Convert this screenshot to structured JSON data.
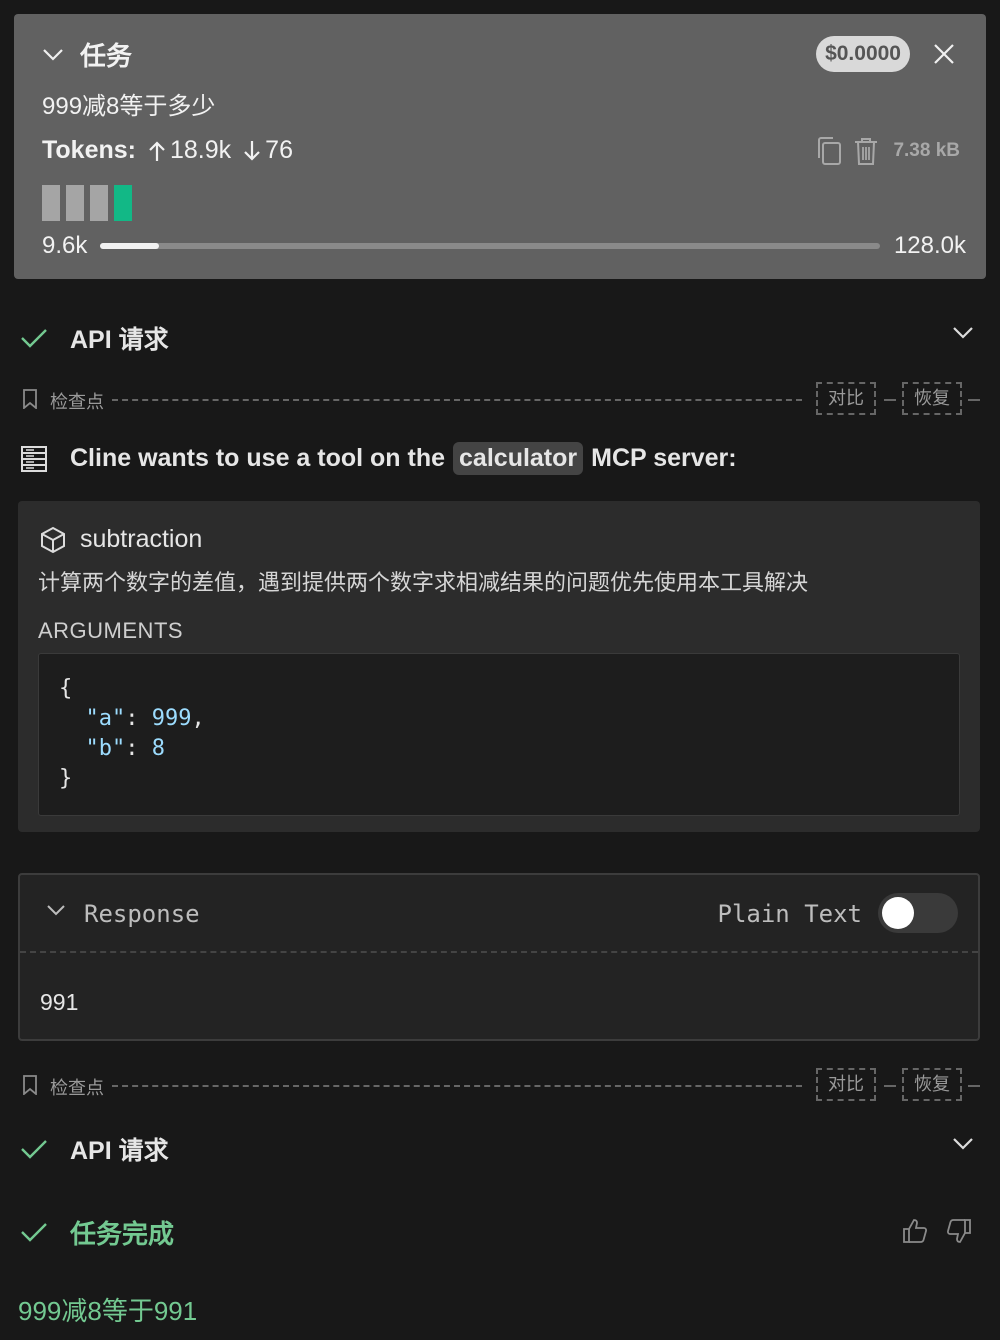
{
  "task": {
    "title": "任务",
    "cost": "$0.0000",
    "question": "999减8等于多少",
    "tokens_label": "Tokens:",
    "tokens_in": "18.9k",
    "tokens_out": "76",
    "size": "7.38 kB",
    "context_used": "9.6k",
    "context_total": "128.0k",
    "context_fraction": 0.075
  },
  "api_requests": [
    {
      "label": "API 请求"
    },
    {
      "label": "API 请求"
    }
  ],
  "checkpoints": [
    {
      "label": "检查点",
      "compare": "对比",
      "restore": "恢复"
    },
    {
      "label": "检查点",
      "compare": "对比",
      "restore": "恢复"
    }
  ],
  "mcp": {
    "intro_before": "Cline wants to use a tool on the",
    "server": "calculator",
    "intro_after": "MCP server:",
    "tool_name": "subtraction",
    "tool_description": "计算两个数字的差值，遇到提供两个数字求相减结果的问题优先使用本工具解决",
    "arguments_label": "ARGUMENTS",
    "arguments": {
      "open": "{",
      "a_key": "\"a\"",
      "a_val": "999",
      "b_key": "\"b\"",
      "b_val": "8",
      "close": "}"
    }
  },
  "response": {
    "title": "Response",
    "plain_text_label": "Plain Text",
    "plain_text_on": false,
    "body": "991"
  },
  "completion": {
    "label": "任务完成",
    "answer": "999减8等于991"
  },
  "colors": {
    "accent_green": "#73c991",
    "context_green": "#12b886",
    "task_card_bg": "#616161"
  }
}
